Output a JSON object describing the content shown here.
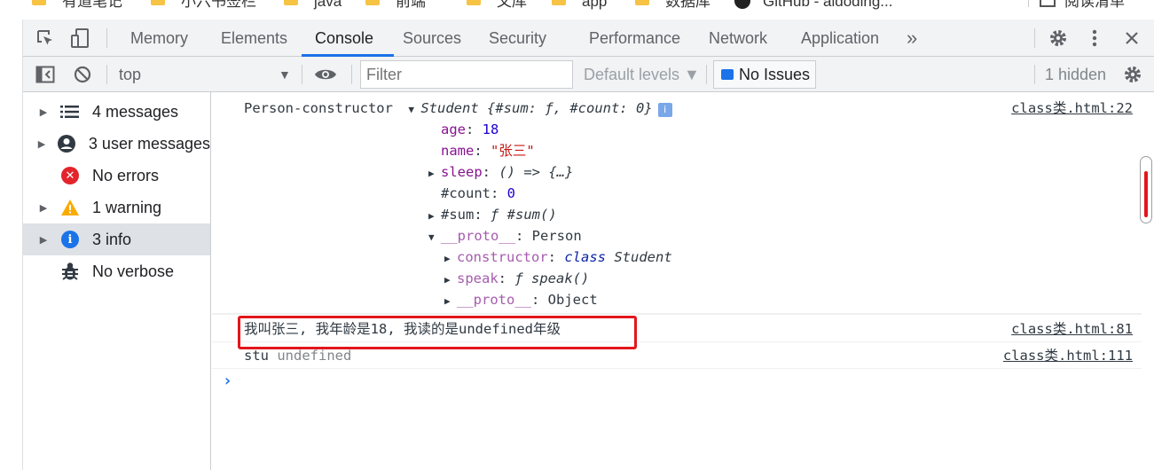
{
  "bookmarks": [
    "有道笔记",
    "小六书签栏",
    "java",
    "前端",
    "文库",
    "app",
    "数据库",
    "GitHub - aldoding..."
  ],
  "reading_list": "阅读清单",
  "tabs": {
    "memory": "Memory",
    "elements": "Elements",
    "console": "Console",
    "sources": "Sources",
    "security": "Security",
    "performance": "Performance",
    "network": "Network",
    "application": "Application",
    "more": "»"
  },
  "toolbar": {
    "context": "top",
    "filter_placeholder": "Filter",
    "levels": "Default levels ▼",
    "issues": "No Issues",
    "hidden": "1 hidden"
  },
  "sidebar": {
    "items": [
      {
        "label": "4 messages",
        "icon": "list-icon"
      },
      {
        "label": "3 user messages",
        "icon": "user-icon"
      },
      {
        "label": "No errors",
        "icon": "error-icon"
      },
      {
        "label": "1 warning",
        "icon": "warning-icon"
      },
      {
        "label": "3 info",
        "icon": "info-icon"
      },
      {
        "label": "No verbose",
        "icon": "bug-icon"
      }
    ]
  },
  "console": {
    "msg1": {
      "prefix": "Person-constructor",
      "class_name": "Student",
      "summary": "{#sum: ƒ, #count: 0}",
      "info_badge": "i",
      "source": "class类.html:22",
      "props": {
        "age_key": "age",
        "age_val": "18",
        "name_key": "name",
        "name_val": "\"张三\"",
        "sleep_key": "sleep",
        "sleep_val": "() => {…}",
        "count_key": "#count",
        "count_val": "0",
        "sum_key": "#sum",
        "sum_val": "ƒ #sum()",
        "proto_key": "__proto__",
        "proto_val": "Person",
        "ctor_key": "constructor",
        "ctor_kw": "class",
        "ctor_val": "Student",
        "speak_key": "speak",
        "speak_val": "ƒ speak()",
        "proto2_key": "__proto__",
        "proto2_val": "Object"
      }
    },
    "msg2": {
      "text": "我叫张三, 我年龄是18, 我读的是undefined年级",
      "source": "class类.html:81"
    },
    "msg3": {
      "label": "stu",
      "value": "undefined",
      "source": "class类.html:111"
    },
    "prompt": "›"
  },
  "colors": {
    "accent": "#1a73e8",
    "highlight_box": "#e3161b",
    "error": "#e3242b",
    "warning": "#f9ab00",
    "info": "#1a73e8"
  }
}
